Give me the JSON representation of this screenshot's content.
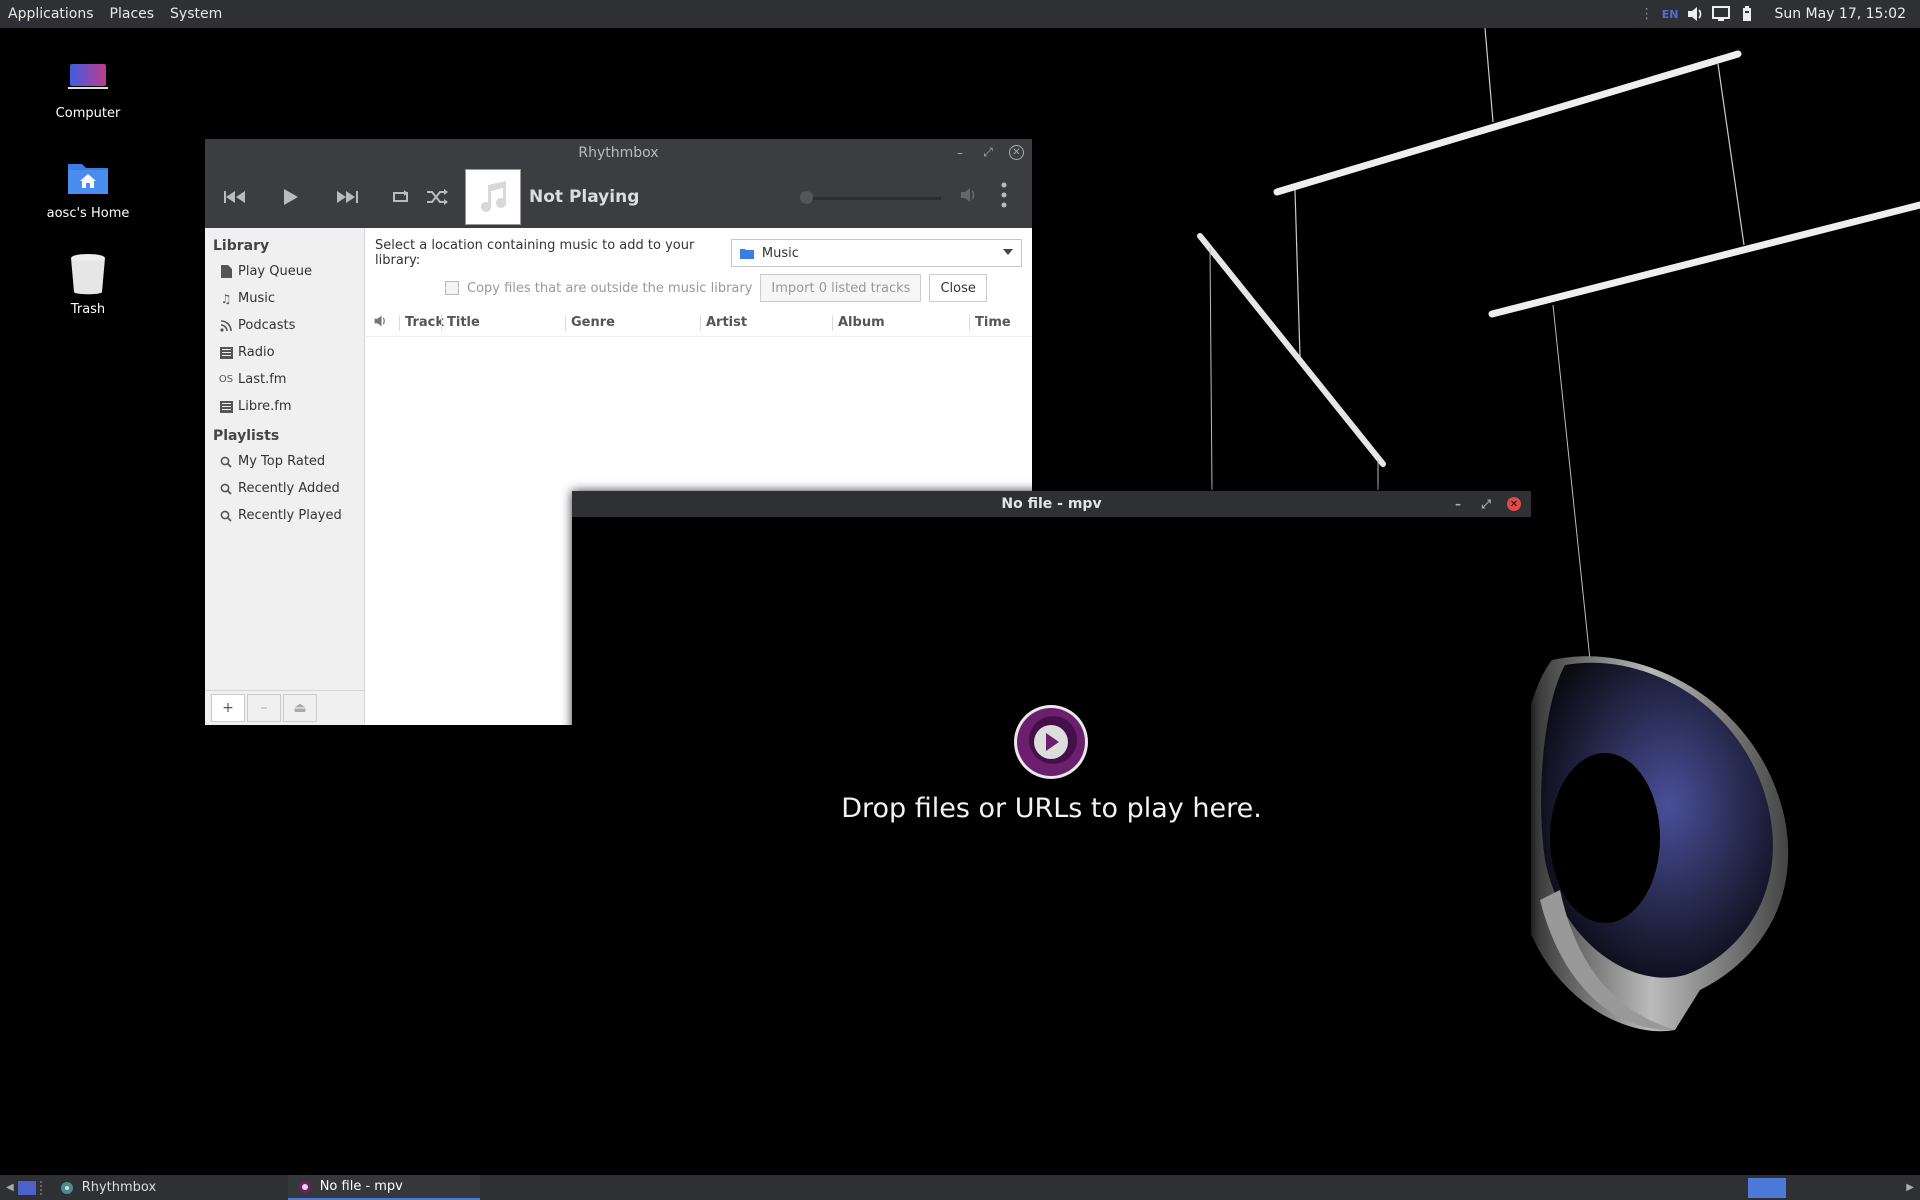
{
  "top_panel": {
    "menus": [
      "Applications",
      "Places",
      "System"
    ],
    "tray": {
      "keyboard_layout": "EN"
    },
    "clock": "Sun May 17, 15:02"
  },
  "desktop": {
    "icons": [
      {
        "label": "Computer",
        "icon": "computer-icon"
      },
      {
        "label": "aosc's Home",
        "icon": "home-folder-icon"
      },
      {
        "label": "Trash",
        "icon": "trash-icon"
      }
    ]
  },
  "rhythmbox": {
    "title": "Rhythmbox",
    "now_playing": "Not Playing",
    "library_header": "Library",
    "library_items": [
      "Play Queue",
      "Music",
      "Podcasts",
      "Radio",
      "Last.fm",
      "Libre.fm"
    ],
    "playlists_header": "Playlists",
    "playlist_items": [
      "My Top Rated",
      "Recently Added",
      "Recently Played"
    ],
    "location_prompt": "Select a location containing music to add to your library:",
    "location_value": "Music",
    "copy_files_label": "Copy files that are outside the music library",
    "import_button": "Import 0 listed tracks",
    "close_button": "Close",
    "columns": [
      "Track",
      "Title",
      "Genre",
      "Artist",
      "Album",
      "Time"
    ]
  },
  "mpv": {
    "title": "No file - mpv",
    "drop_text": "Drop files or URLs to play here."
  },
  "taskbar": {
    "tasks": [
      "Rhythmbox",
      "No file - mpv"
    ]
  },
  "colors": {
    "panel": "#2f3033",
    "accent": "#4d79d8",
    "mpv_purple": "#6b1f6d",
    "close_red": "#e04a4a"
  }
}
